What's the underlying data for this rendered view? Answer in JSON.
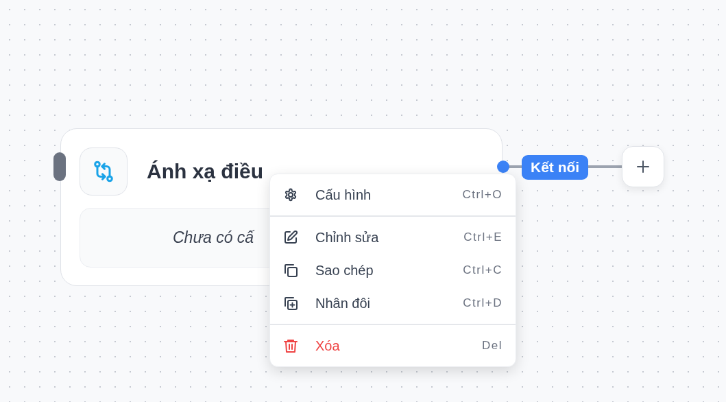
{
  "canvas": {
    "node": {
      "title": "Ánh xạ điều",
      "placeholder": "Chưa có cấ"
    },
    "connection": {
      "label": "Kết nối"
    }
  },
  "context_menu": {
    "sections": [
      {
        "items": [
          {
            "kind": "configure",
            "label": "Cấu hình",
            "shortcut": "Ctrl+O",
            "danger": false
          }
        ]
      },
      {
        "items": [
          {
            "kind": "edit",
            "label": "Chỉnh sửa",
            "shortcut": "Ctrl+E",
            "danger": false
          },
          {
            "kind": "copy",
            "label": "Sao chép",
            "shortcut": "Ctrl+C",
            "danger": false
          },
          {
            "kind": "duplicate",
            "label": "Nhân đôi",
            "shortcut": "Ctrl+D",
            "danger": false
          }
        ]
      },
      {
        "items": [
          {
            "kind": "delete",
            "label": "Xóa",
            "shortcut": "Del",
            "danger": true
          }
        ]
      }
    ]
  }
}
